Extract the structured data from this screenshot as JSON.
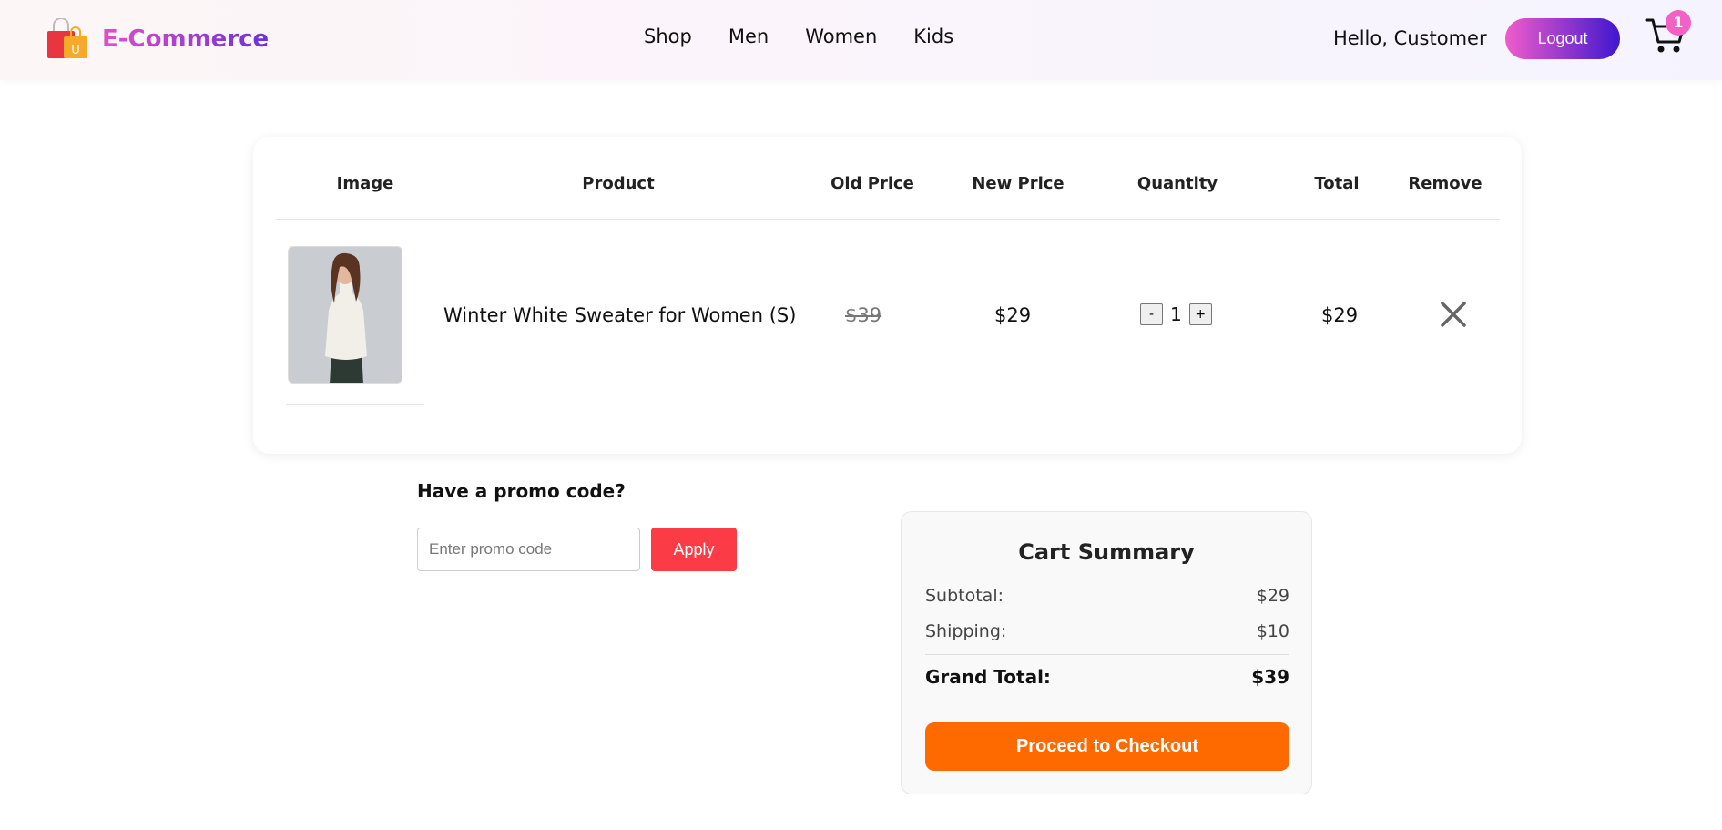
{
  "header": {
    "brand": "E-Commerce",
    "nav": [
      {
        "label": "Shop"
      },
      {
        "label": "Men"
      },
      {
        "label": "Women"
      },
      {
        "label": "Kids"
      }
    ],
    "greeting": "Hello, Customer",
    "logout_label": "Logout",
    "cart_count": "1"
  },
  "table": {
    "columns": [
      "Image",
      "Product",
      "Old Price",
      "New Price",
      "Quantity",
      "Total",
      "Remove"
    ],
    "rows": [
      {
        "product": "Winter White Sweater for Women (S)",
        "old_price": "$39",
        "new_price": "$29",
        "quantity": "1",
        "total": "$29"
      }
    ],
    "qty_minus": "-",
    "qty_plus": "+"
  },
  "promo": {
    "title": "Have a promo code?",
    "placeholder": "Enter promo code",
    "apply_label": "Apply"
  },
  "summary": {
    "title": "Cart Summary",
    "subtotal_label": "Subtotal:",
    "subtotal": "$29",
    "shipping_label": "Shipping:",
    "shipping": "$10",
    "grand_total_label": "Grand Total:",
    "grand_total": "$39",
    "checkout_label": "Proceed to Checkout"
  },
  "colors": {
    "brand_gradient_start": "#e14ec7",
    "brand_gradient_end": "#6b32d8",
    "apply_button": "#fb3b46",
    "checkout_button": "#ff6a00",
    "badge": "#f262c6"
  }
}
